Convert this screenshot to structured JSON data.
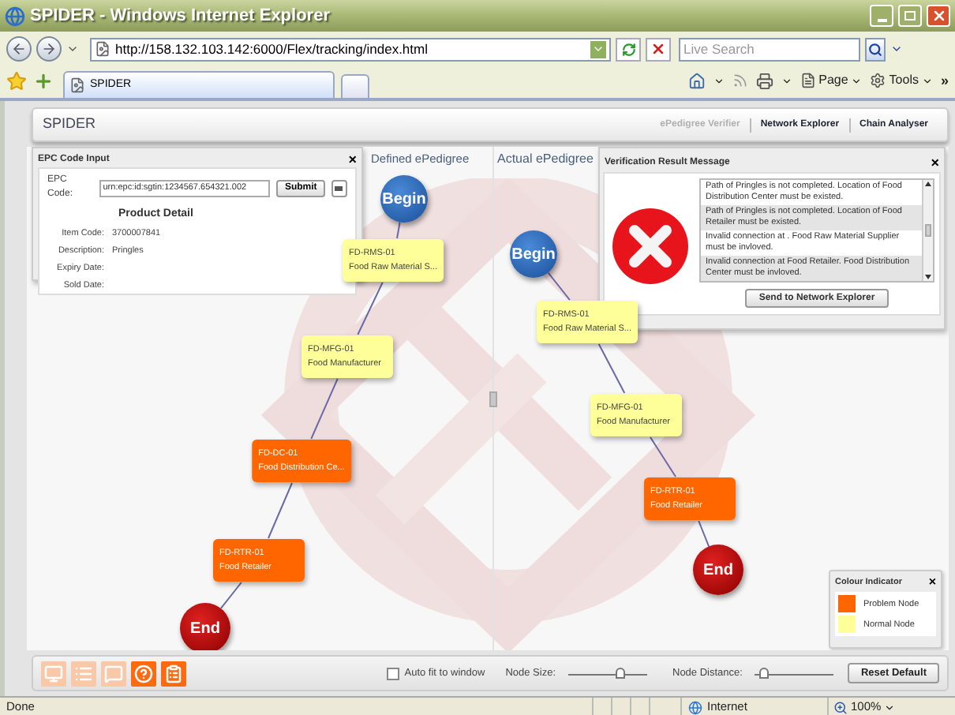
{
  "browser": {
    "title": "SPIDER - Windows Internet Explorer",
    "address": "http://158.132.103.142:6000/Flex/tracking/index.html",
    "search_placeholder": "Live Search",
    "tab": "SPIDER",
    "commands": [
      "Page",
      "Tools"
    ],
    "more": "»",
    "status": "Done",
    "zone": "Internet",
    "zoom": "100%"
  },
  "app": {
    "title": "SPIDER",
    "nav": [
      {
        "label": "ePedigree Verifier",
        "disabled": true
      },
      {
        "label": "Network Explorer",
        "disabled": false
      },
      {
        "label": "Chain Analyser",
        "disabled": false
      }
    ]
  },
  "epc_panel": {
    "title": "EPC Code Input",
    "close": "×",
    "code_label": "EPC Code:",
    "code_value": "urn:epc:id:sgtin:1234567.654321.002",
    "submit": "Submit",
    "detail_title": "Product Detail",
    "rows": [
      {
        "label": "Item Code:",
        "value": "3700007841"
      },
      {
        "label": "Description:",
        "value": "Pringles"
      },
      {
        "label": "Expiry Date:"
      },
      {
        "label": "Sold Date:"
      }
    ]
  },
  "graphs": [
    {
      "title": "Defined ePedigree",
      "nodes": [
        {
          "kind": "begin",
          "label": "Begin"
        },
        {
          "kind": "node",
          "code": "FD-RMS-01",
          "name": "Food Raw Material S...",
          "color": "#ffff99"
        },
        {
          "kind": "node",
          "code": "FD-MFG-01",
          "name": "Food Manufacturer",
          "color": "#ffff99"
        },
        {
          "kind": "node",
          "code": "FD-DC-01",
          "name": "Food Distribution Ce...",
          "color": "#ff6600"
        },
        {
          "kind": "node",
          "code": "FD-RTR-01",
          "name": "Food Retailer",
          "color": "#ff6600"
        },
        {
          "kind": "end",
          "label": "End"
        }
      ]
    },
    {
      "title": "Actual ePedigree",
      "nodes": [
        {
          "kind": "begin",
          "label": "Begin"
        },
        {
          "kind": "node",
          "code": "FD-RMS-01",
          "name": "Food Raw Material S...",
          "color": "#ffff99"
        },
        {
          "kind": "node",
          "code": "FD-MFG-01",
          "name": "Food Manufacturer",
          "color": "#ffff99"
        },
        {
          "kind": "node",
          "code": "FD-RTR-01",
          "name": "Food Retailer",
          "color": "#ff6600"
        },
        {
          "kind": "end",
          "label": "End"
        }
      ]
    }
  ],
  "verification": {
    "title": "Verification Result Message",
    "close": "×",
    "messages": [
      "Path of Pringles is not completed. Location of Food Distribution Center must be existed.",
      "Path of Pringles is not completed. Location of Food Retailer must be existed.",
      "Invalid connection at . Food Raw Material Supplier must be invloved.",
      "Invalid connection at Food Retailer. Food Distribution Center must be invloved."
    ],
    "button": "Send to Network Explorer"
  },
  "legend": {
    "title": "Colour Indicator",
    "close": "×",
    "items": [
      {
        "label": "Problem Node",
        "color": "#ff6600"
      },
      {
        "label": "Normal Node",
        "color": "#ffff99"
      }
    ]
  },
  "toolbar": {
    "tools": [
      {
        "disabled": true
      },
      {
        "disabled": true
      },
      {
        "disabled": true
      },
      {
        "disabled": false
      },
      {
        "disabled": false
      }
    ],
    "auto_fit": {
      "label": "Auto fit to window",
      "checked": false
    },
    "node_size": {
      "label": "Node Size:",
      "level": 0.65
    },
    "node_distance": {
      "label": "Node Distance:",
      "level": 0.12
    },
    "reset": "Reset Default"
  }
}
